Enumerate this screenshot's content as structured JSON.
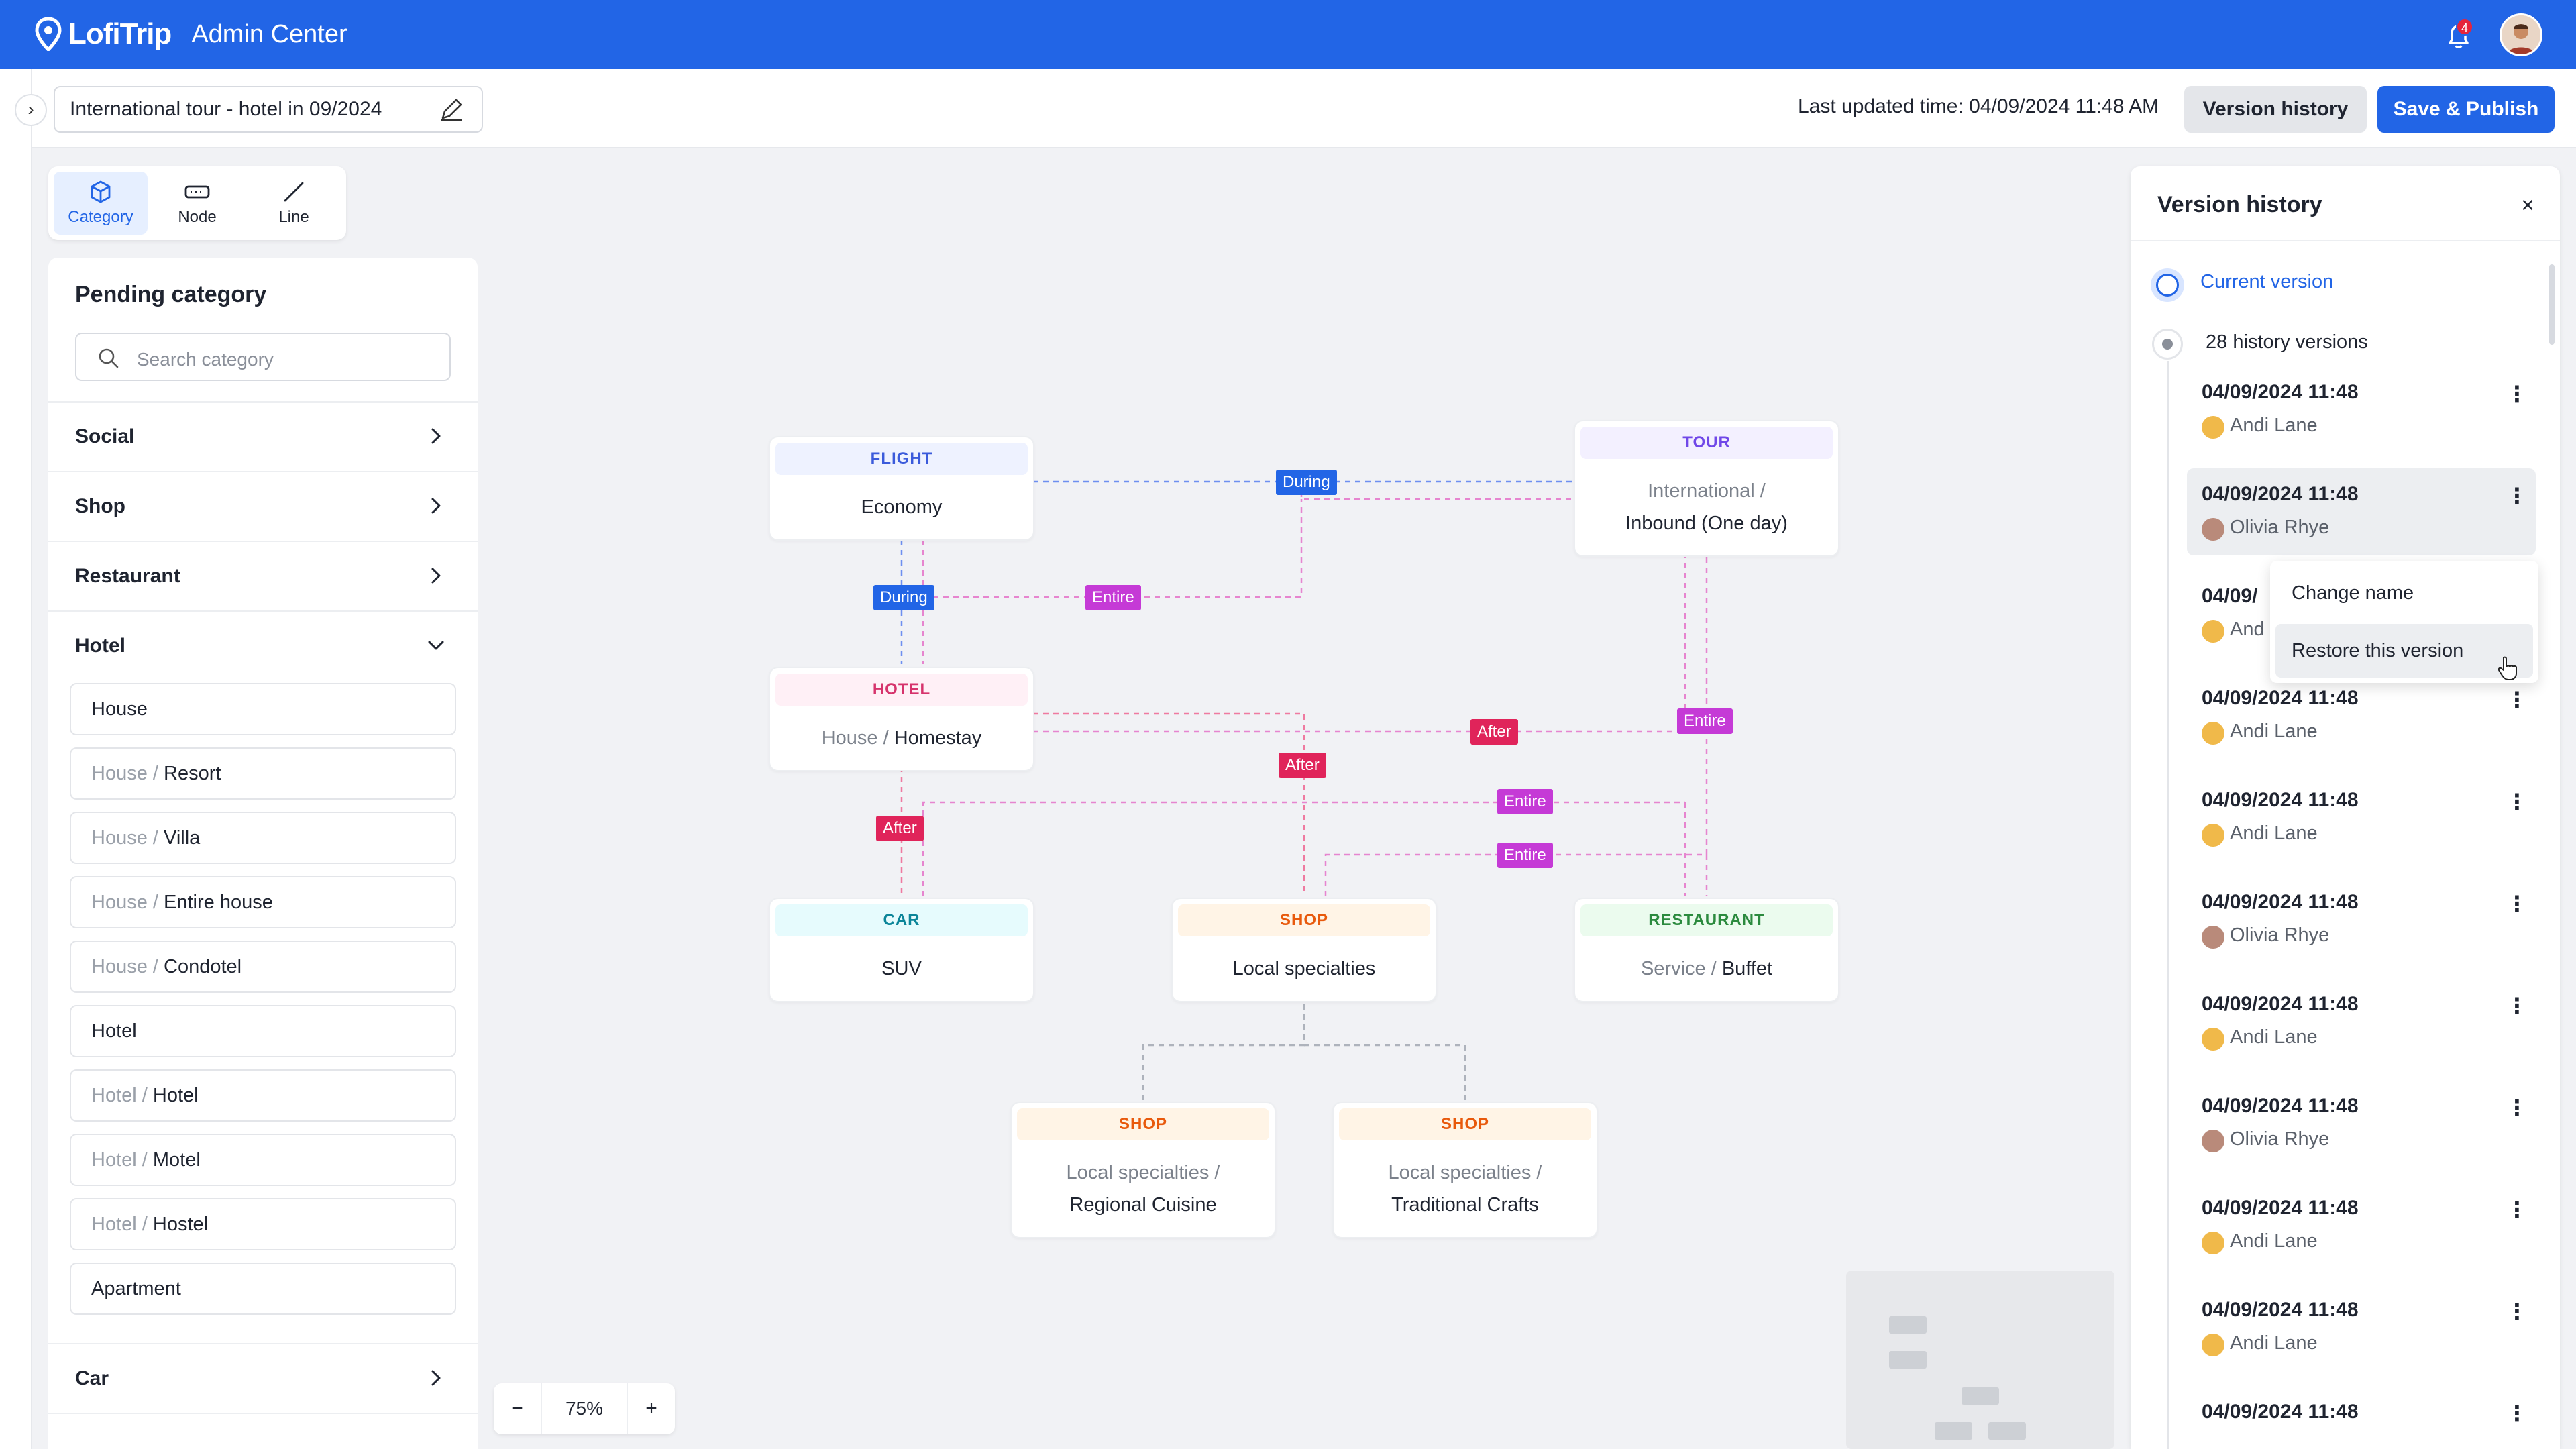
{
  "app": {
    "brand": "LofiTrip",
    "title": "Admin Center",
    "notification_count": "4"
  },
  "header": {
    "document_name": "International tour - hotel in 09/2024",
    "last_updated": "Last updated time: 04/09/2024 11:48 AM",
    "version_history_label": "Version history",
    "publish_label": "Save & Publish"
  },
  "tools": [
    {
      "label": "Category",
      "icon": "cube-icon",
      "active": true
    },
    {
      "label": "Node",
      "icon": "node-icon",
      "active": false
    },
    {
      "label": "Line",
      "icon": "line-icon",
      "active": false
    }
  ],
  "left_panel": {
    "title": "Pending category",
    "search_placeholder": "Search category",
    "categories": [
      "Social",
      "Shop",
      "Restaurant",
      "Hotel",
      "Car"
    ],
    "hotel_items": [
      {
        "prefix": "",
        "name": "House"
      },
      {
        "prefix": "House / ",
        "name": "Resort"
      },
      {
        "prefix": "House / ",
        "name": "Villa"
      },
      {
        "prefix": "House / ",
        "name": "Entire house"
      },
      {
        "prefix": "House / ",
        "name": "Condotel"
      },
      {
        "prefix": "",
        "name": "Hotel"
      },
      {
        "prefix": "Hotel / ",
        "name": "Hotel"
      },
      {
        "prefix": "Hotel / ",
        "name": "Motel"
      },
      {
        "prefix": "Hotel / ",
        "name": "Hostel"
      },
      {
        "prefix": "",
        "name": "Apartment"
      }
    ]
  },
  "canvas": {
    "nodes": {
      "flight": {
        "type": "FLIGHT",
        "value": "Economy"
      },
      "tour": {
        "type": "TOUR",
        "prefix": "International /",
        "value": "Inbound (One day)"
      },
      "hotel": {
        "type": "HOTEL",
        "prefix": "House / ",
        "value": "Homestay"
      },
      "car": {
        "type": "CAR",
        "value": "SUV"
      },
      "shop": {
        "type": "SHOP",
        "value": "Local specialties"
      },
      "restaurant": {
        "type": "RESTAURANT",
        "prefix": "Service / ",
        "value": "Buffet"
      },
      "shop2": {
        "type": "SHOP",
        "prefix": "Local specialties /",
        "value": "Regional Cuisine"
      },
      "shop3": {
        "type": "SHOP",
        "prefix": "Local specialties /",
        "value": "Traditional Crafts"
      }
    },
    "relations": {
      "during": "During",
      "entire": "Entire",
      "after": "After"
    },
    "zoom": "75%"
  },
  "version_history": {
    "title": "Version history",
    "current": "Current version",
    "history_count": "28 history versions",
    "entries": [
      {
        "date": "04/09/2024 11:48",
        "user": "Andi Lane"
      },
      {
        "date": "04/09/2024 11:48",
        "user": "Olivia Rhye"
      },
      {
        "date": "04/09/",
        "user": "And"
      },
      {
        "date": "04/09/2024 11:48",
        "user": "Andi Lane"
      },
      {
        "date": "04/09/2024 11:48",
        "user": "Andi Lane"
      },
      {
        "date": "04/09/2024 11:48",
        "user": "Olivia Rhye"
      },
      {
        "date": "04/09/2024 11:48",
        "user": "Andi Lane"
      },
      {
        "date": "04/09/2024 11:48",
        "user": "Olivia Rhye"
      },
      {
        "date": "04/09/2024 11:48",
        "user": "Andi Lane"
      },
      {
        "date": "04/09/2024 11:48",
        "user": "Andi Lane"
      },
      {
        "date": "04/09/2024 11:48",
        "user": ""
      }
    ],
    "menu": {
      "change_name": "Change name",
      "restore": "Restore this version"
    }
  },
  "colors": {
    "primary": "#2265e6",
    "flight": "#3b5bdb",
    "tour": "#7048e8",
    "hotel": "#d6336c",
    "car": "#0c8599",
    "shop": "#e8590c",
    "restaurant": "#2b8a3e"
  }
}
